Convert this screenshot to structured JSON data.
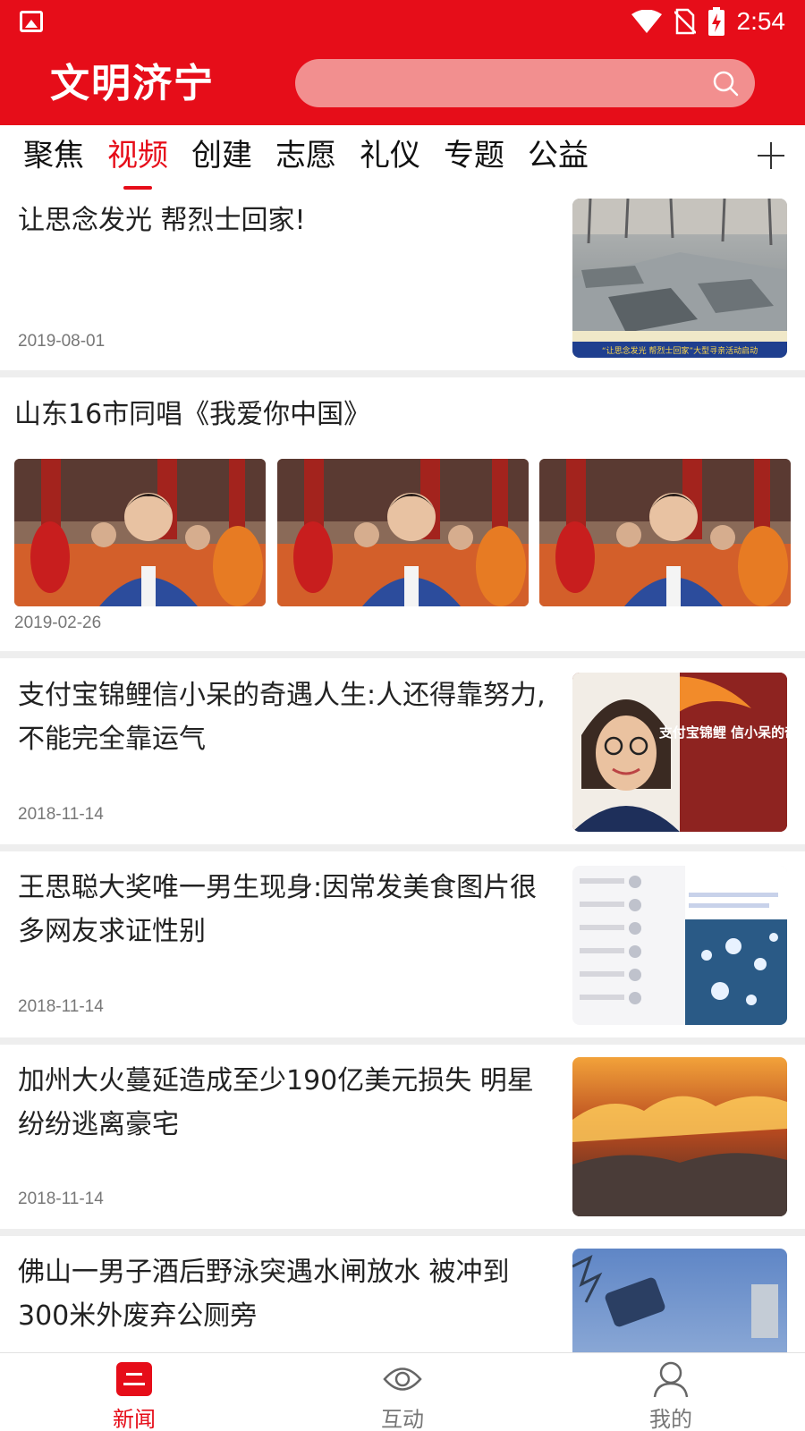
{
  "status_bar": {
    "time": "2:54"
  },
  "app": {
    "title": "文明济宁",
    "search": {
      "placeholder": ""
    }
  },
  "tabs": [
    {
      "label": "聚焦",
      "active": false
    },
    {
      "label": "视频",
      "active": true
    },
    {
      "label": "创建",
      "active": false
    },
    {
      "label": "志愿",
      "active": false
    },
    {
      "label": "礼仪",
      "active": false
    },
    {
      "label": "专题",
      "active": false
    },
    {
      "label": "公益",
      "active": false
    }
  ],
  "feed": [
    {
      "title": "让思念发光 帮烈士回家!",
      "date": "2019-08-01",
      "thumb_caption": "“让思念发光 帮烈士回家”大型寻亲活动启动"
    },
    {
      "title": "山东16市同唱《我爱你中国》",
      "date": "2019-02-26"
    },
    {
      "title": "支付宝锦鲤信小呆的奇遇人生:人还得靠努力,不能完全靠运气",
      "date": "2018-11-14",
      "thumb_caption": "支付宝锦鲤 信小呆的奇遇"
    },
    {
      "title": "王思聪大奖唯一男生现身:因常发美食图片很多网友求证性别",
      "date": "2018-11-14"
    },
    {
      "title": "加州大火蔓延造成至少190亿美元损失 明星纷纷逃离豪宅",
      "date": "2018-11-14"
    },
    {
      "title": "佛山一男子酒后野泳突遇水闸放水 被冲到300米外废弃公厕旁",
      "date": ""
    }
  ],
  "bottom_nav": [
    {
      "label": "新闻",
      "icon": "news-icon",
      "active": true
    },
    {
      "label": "互动",
      "icon": "eye-icon",
      "active": false
    },
    {
      "label": "我的",
      "icon": "user-icon",
      "active": false
    }
  ],
  "colors": {
    "brand_red": "#e60d19",
    "search_pink": "#f28f8f",
    "separator": "#eeeeee"
  }
}
